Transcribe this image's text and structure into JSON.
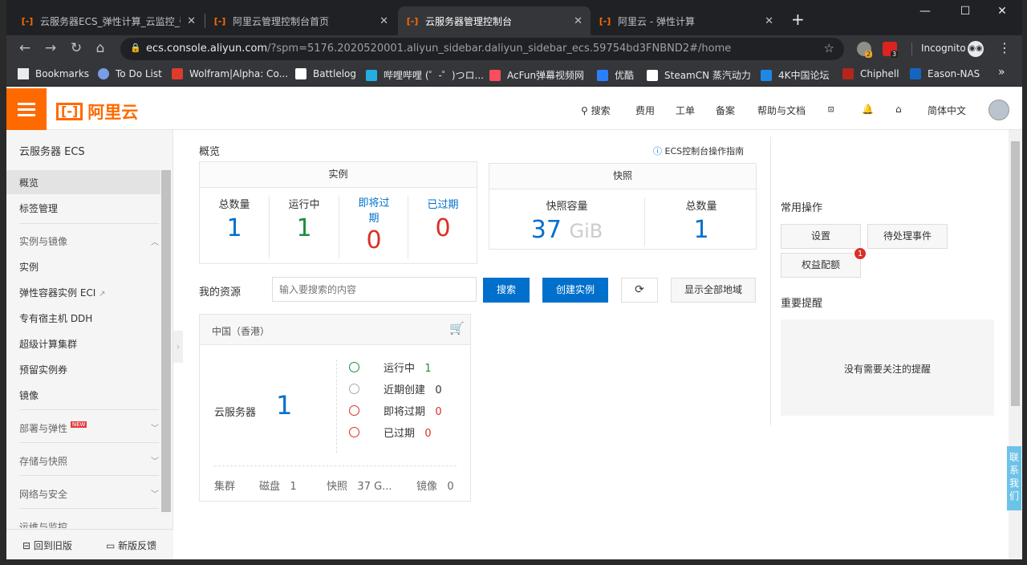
{
  "browser": {
    "tabs": [
      {
        "title": "云服务器ECS_弹性计算_云监控_弹"
      },
      {
        "title": "阿里云管理控制台首页"
      },
      {
        "title": "云服务器管理控制台"
      },
      {
        "title": "阿里云 - 弹性计算"
      }
    ],
    "url_host": "ecs.console.aliyun.com",
    "url_rest": "/?spm=5176.2020520001.aliyun_sidebar.daliyun_sidebar_ecs.59754bd3FNBND2#/home",
    "incognito_label": "Incognito",
    "ext_badges": [
      "2",
      "3"
    ],
    "bookmarks": [
      {
        "label": "Bookmarks"
      },
      {
        "label": "To Do List"
      },
      {
        "label": "Wolfram|Alpha: Co..."
      },
      {
        "label": "Battlelog"
      },
      {
        "label": "哔哩哔哩 (゜-゜)つロ..."
      },
      {
        "label": "AcFun弹幕视频网"
      },
      {
        "label": "优酷"
      },
      {
        "label": "SteamCN 蒸汽动力"
      },
      {
        "label": "4K中国论坛"
      },
      {
        "label": "Chiphell"
      },
      {
        "label": "Eason-NAS"
      }
    ],
    "more_label": "»"
  },
  "header": {
    "logo_text": "阿里云",
    "logo_mark": "[-]",
    "nav": [
      "搜索",
      "费用",
      "工单",
      "备案",
      "帮助与文档"
    ],
    "language": "简体中文"
  },
  "sidebar": {
    "title": "云服务器 ECS",
    "items": [
      "概览",
      "标签管理"
    ],
    "group1": "实例与镜像",
    "group1_items": [
      "实例",
      "弹性容器实例 ECI",
      "专有宿主机 DDH",
      "超级计算集群",
      "预留实例券",
      "镜像"
    ],
    "groups": [
      "部署与弹性",
      "存储与快照",
      "网络与安全",
      "运维与监控"
    ],
    "new_badge": "NEW",
    "footer": [
      "回到旧版",
      "新版反馈"
    ]
  },
  "overview": {
    "title": "概览",
    "guide_link": "ECS控制台操作指南",
    "instances": {
      "header": "实例",
      "stats": [
        {
          "label": "总数量",
          "value": "1"
        },
        {
          "label": "运行中",
          "value": "1"
        },
        {
          "label": "即将过期",
          "value": "0"
        },
        {
          "label": "已过期",
          "value": "0"
        }
      ]
    },
    "snapshots": {
      "header": "快照",
      "capacity_label": "快照容量",
      "capacity_value": "37",
      "capacity_unit": "GiB",
      "count_label": "总数量",
      "count_value": "1"
    }
  },
  "resources": {
    "label": "我的资源",
    "search_placeholder": "输入要搜索的内容",
    "search_button": "搜索",
    "create_button": "创建实例",
    "show_all_button": "显示全部地域",
    "region_card": {
      "region": "中国（香港）",
      "server_label": "云服务器",
      "server_count": "1",
      "statuses": [
        {
          "label": "运行中",
          "value": "1"
        },
        {
          "label": "近期创建",
          "value": "0"
        },
        {
          "label": "即将过期",
          "value": "0"
        },
        {
          "label": "已过期",
          "value": "0"
        }
      ],
      "footer": [
        {
          "label": "集群",
          "value": ""
        },
        {
          "label": "磁盘",
          "value": "1"
        },
        {
          "label": "快照",
          "value": "37 G..."
        },
        {
          "label": "镜像",
          "value": "0"
        }
      ]
    }
  },
  "right": {
    "common_ops_title": "常用操作",
    "ops": [
      "设置",
      "待处理事件",
      "权益配额"
    ],
    "ops_badge": "1",
    "reminders_title": "重要提醒",
    "reminders_empty": "没有需要关注的提醒",
    "contact": [
      "联",
      "系",
      "我",
      "们"
    ]
  },
  "colors": {
    "brand": "#ff6a00",
    "primary": "#0070cc",
    "running": "#1e8e3e",
    "expired": "#d93026"
  }
}
